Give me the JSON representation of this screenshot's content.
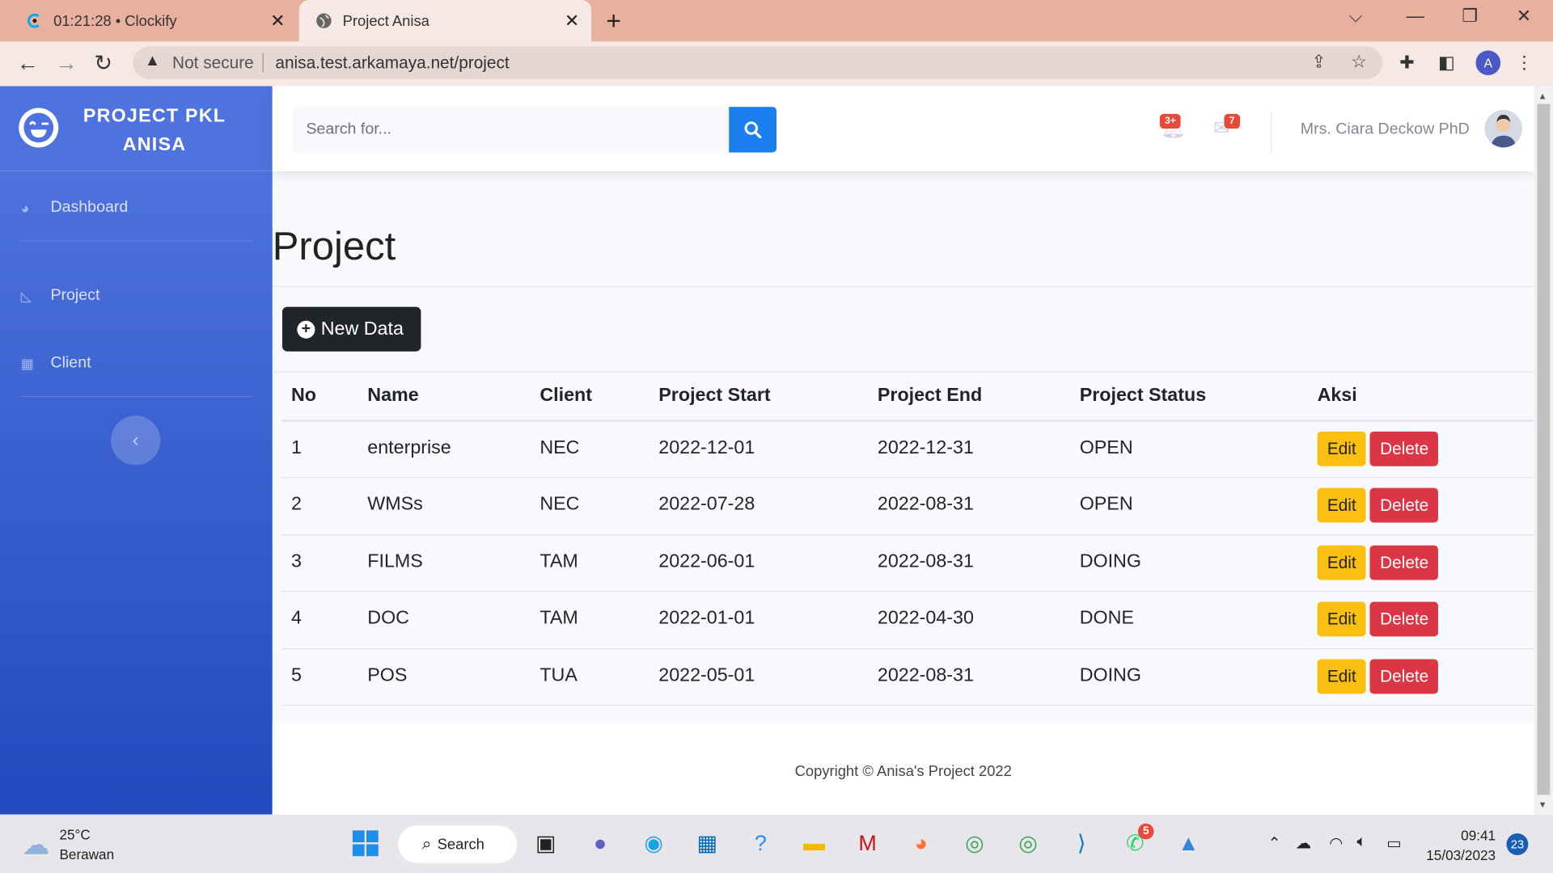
{
  "browser": {
    "tabs": [
      {
        "title": "01:21:28 • Clockify",
        "icon": "clockify-icon"
      },
      {
        "title": "Project Anisa",
        "icon": "globe-icon"
      }
    ],
    "not_secure": "Not secure",
    "url": "anisa.test.arkamaya.net/project",
    "profile_initial": "A"
  },
  "sidebar": {
    "brand": "PROJECT PKL ANISA",
    "items": [
      {
        "label": "Dashboard",
        "icon": "palette-icon"
      },
      {
        "label": "Project",
        "icon": "chart-area-icon"
      },
      {
        "label": "Client",
        "icon": "table-icon"
      }
    ],
    "toggle_icon": "chevron-left-icon"
  },
  "topbar": {
    "search_placeholder": "Search for...",
    "alerts_count": "3+",
    "messages_count": "7",
    "user_name": "Mrs. Ciara Deckow PhD"
  },
  "main": {
    "title": "Project",
    "new_button": "New Data",
    "columns": [
      "No",
      "Name",
      "Client",
      "Project Start",
      "Project End",
      "Project Status",
      "Aksi"
    ],
    "rows": [
      {
        "no": "1",
        "name": "enterprise",
        "client": "NEC",
        "start": "2022-12-01",
        "end": "2022-12-31",
        "status": "OPEN"
      },
      {
        "no": "2",
        "name": "WMSs",
        "client": "NEC",
        "start": "2022-07-28",
        "end": "2022-08-31",
        "status": "OPEN"
      },
      {
        "no": "3",
        "name": "FILMS",
        "client": "TAM",
        "start": "2022-06-01",
        "end": "2022-08-31",
        "status": "DOING"
      },
      {
        "no": "4",
        "name": "DOC",
        "client": "TAM",
        "start": "2022-01-01",
        "end": "2022-04-30",
        "status": "DONE"
      },
      {
        "no": "5",
        "name": "POS",
        "client": "TUA",
        "start": "2022-05-01",
        "end": "2022-08-31",
        "status": "DOING"
      }
    ],
    "edit_label": "Edit",
    "delete_label": "Delete"
  },
  "footer": {
    "copyright": "Copyright © Anisa's Project 2022"
  },
  "taskbar": {
    "temperature": "25°C",
    "weather": "Berawan",
    "search": "Search",
    "whatsapp_badge": "5",
    "time": "09:41",
    "date": "15/03/2023",
    "notifications": "23"
  },
  "colors": {
    "primary": "#4e73df",
    "danger": "#dc3545",
    "warning": "#fbbf0f",
    "dark": "#212529"
  }
}
